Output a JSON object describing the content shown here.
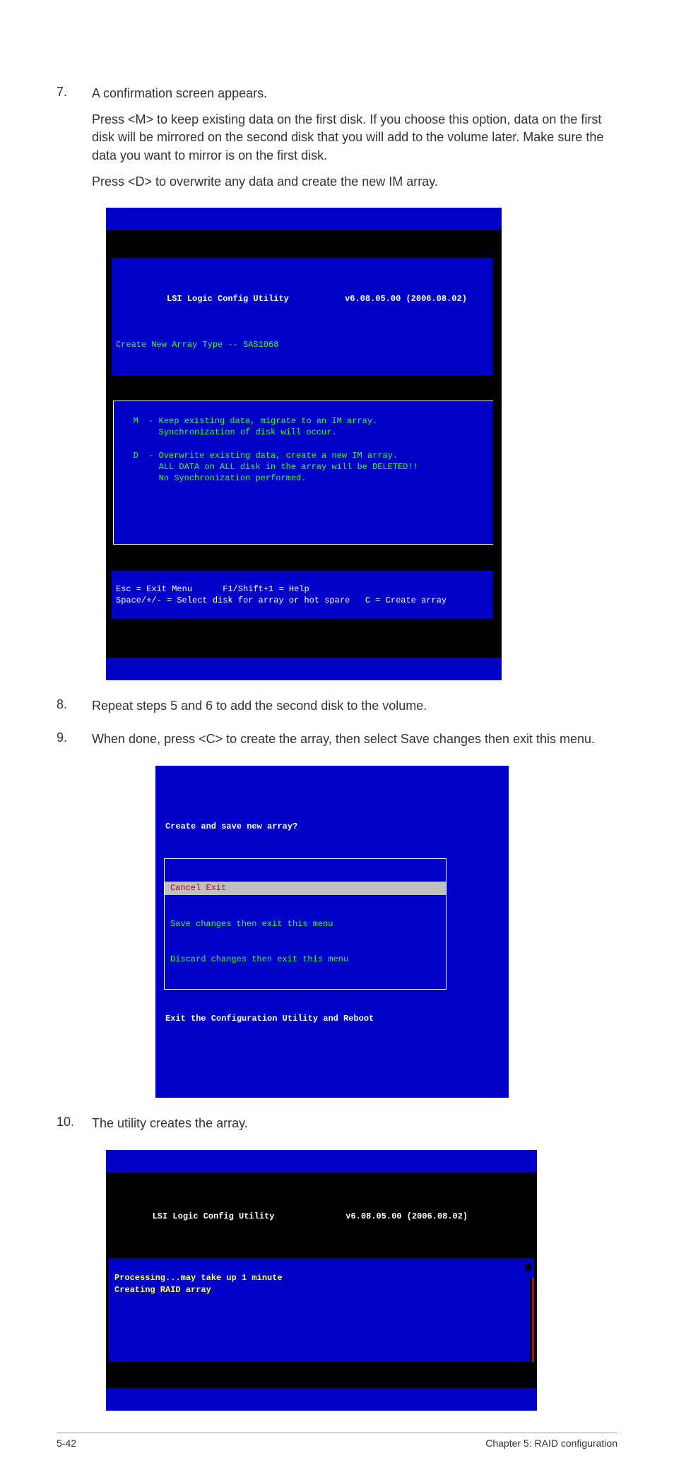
{
  "steps": {
    "s7": {
      "num": "7.",
      "line1": "A confirmation screen appears.",
      "line2": "Press <M> to keep existing data on the first disk. If you choose this option, data on the first disk will be mirrored on the second disk that you will add to the volume later. Make sure the data you want to mirror is on the first disk.",
      "line3": " Press <D> to overwrite any data and create the new IM array."
    },
    "s8": {
      "num": "8.",
      "text": "Repeat steps 5 and 6 to add the second disk to the volume."
    },
    "s9": {
      "num": "9.",
      "text": "When done, press <C> to create the array, then select Save changes then exit this menu."
    },
    "s10": {
      "num": "10.",
      "text": "The utility creates the array."
    }
  },
  "term1": {
    "title_left": "LSI Logic Config Utility",
    "title_right": "v6.08.05.00 (2006.08.02)",
    "subtitle": "Create New Array Type -- SAS1068",
    "optM_l1": "M  - Keep existing data, migrate to an IM array.",
    "optM_l2": "     Synchronization of disk will occur.",
    "optD_l1": "D  - Overwrite existing data, create a new IM array.",
    "optD_l2": "     ALL DATA on ALL disk in the array will be DELETED!!",
    "optD_l3": "     No Synchronization performed.",
    "foot_l1_a": "Esc = Exit Menu",
    "foot_l1_b": "F1/Shift+1 = Help",
    "foot_l2_a": "Space/+/- = Select disk for array or hot spare",
    "foot_l2_b": "C = Create array"
  },
  "term2": {
    "title": "Create and save new array?",
    "items": [
      "Cancel Exit",
      "Save changes then exit this menu",
      "Discard changes then exit this menu"
    ],
    "below": "Exit the Configuration Utility and Reboot"
  },
  "term3": {
    "title_left": "LSI Logic Config Utility",
    "title_right": "v6.08.05.00 (2006.08.02)",
    "line1": "Processing...may take up 1 minute",
    "line2": "Creating RAID array"
  },
  "footer": {
    "left": "5-42",
    "right": "Chapter 5: RAID configuration"
  }
}
